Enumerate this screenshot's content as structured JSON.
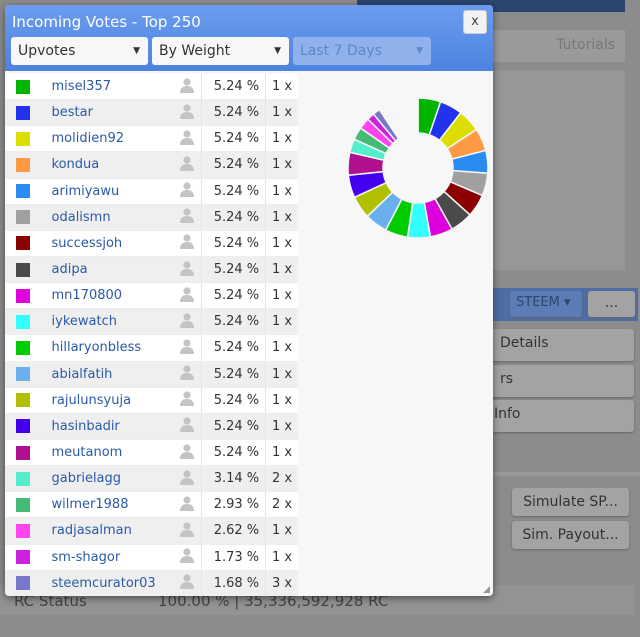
{
  "dialog": {
    "title": "Incoming Votes - Top 250",
    "close": "x",
    "filters": [
      {
        "value": "Upvotes"
      },
      {
        "value": "By Weight"
      },
      {
        "value": "Last 7 Days",
        "disabled": true
      }
    ]
  },
  "votes": [
    {
      "name": "misel357",
      "pct": "5.24 %",
      "count": "1 x",
      "color": "#00b400"
    },
    {
      "name": "bestar",
      "pct": "5.24 %",
      "count": "1 x",
      "color": "#2233ee"
    },
    {
      "name": "molidien92",
      "pct": "5.24 %",
      "count": "1 x",
      "color": "#dddd00"
    },
    {
      "name": "kondua",
      "pct": "5.24 %",
      "count": "1 x",
      "color": "#ff9944"
    },
    {
      "name": "arimiyawu",
      "pct": "5.24 %",
      "count": "1 x",
      "color": "#2a8cf0"
    },
    {
      "name": "odalismn",
      "pct": "5.24 %",
      "count": "1 x",
      "color": "#a0a0a0"
    },
    {
      "name": "successjoh",
      "pct": "5.24 %",
      "count": "1 x",
      "color": "#8b0000"
    },
    {
      "name": "adipa",
      "pct": "5.24 %",
      "count": "1 x",
      "color": "#4a4a4a"
    },
    {
      "name": "mn170800",
      "pct": "5.24 %",
      "count": "1 x",
      "color": "#dd00dd"
    },
    {
      "name": "iykewatch",
      "pct": "5.24 %",
      "count": "1 x",
      "color": "#33ffff"
    },
    {
      "name": "hillaryonbless",
      "pct": "5.24 %",
      "count": "1 x",
      "color": "#00cc00"
    },
    {
      "name": "abialfatih",
      "pct": "5.24 %",
      "count": "1 x",
      "color": "#6ab0ee"
    },
    {
      "name": "rajulunsyuja",
      "pct": "5.24 %",
      "count": "1 x",
      "color": "#b0c000"
    },
    {
      "name": "hasinbadir",
      "pct": "5.24 %",
      "count": "1 x",
      "color": "#4400ee"
    },
    {
      "name": "meutanom",
      "pct": "5.24 %",
      "count": "1 x",
      "color": "#b01090"
    },
    {
      "name": "gabrielagg",
      "pct": "3.14 %",
      "count": "2 x",
      "color": "#55eecc"
    },
    {
      "name": "wilmer1988",
      "pct": "2.93 %",
      "count": "2 x",
      "color": "#44bb77"
    },
    {
      "name": "radjasalman",
      "pct": "2.62 %",
      "count": "1 x",
      "color": "#ff44ee"
    },
    {
      "name": "sm-shagor",
      "pct": "1.73 %",
      "count": "1 x",
      "color": "#cc22dd"
    },
    {
      "name": "steemcurator03",
      "pct": "1.68 %",
      "count": "3 x",
      "color": "#7777cc"
    }
  ],
  "chart_data": {
    "type": "pie",
    "donut": true,
    "categories": [
      "misel357",
      "bestar",
      "molidien92",
      "kondua",
      "arimiyawu",
      "odalismn",
      "successjoh",
      "adipa",
      "mn170800",
      "iykewatch",
      "hillaryonbless",
      "abialfatih",
      "rajulunsyuja",
      "hasinbadir",
      "meutanom",
      "gabrielagg",
      "wilmer1988",
      "radjasalman",
      "sm-shagor",
      "steemcurator03"
    ],
    "values": [
      5.24,
      5.24,
      5.24,
      5.24,
      5.24,
      5.24,
      5.24,
      5.24,
      5.24,
      5.24,
      5.24,
      5.24,
      5.24,
      5.24,
      5.24,
      3.14,
      2.93,
      2.62,
      1.73,
      1.68
    ]
  },
  "background": {
    "tutorials": "Tutorials",
    "currency": "STEEM",
    "more": "...",
    "details": "Details",
    "rs": "rs",
    "info": "Info",
    "simulate_sp": "Simulate SP...",
    "sim_payout": "Sim. Payout...",
    "rc_label": "RC Status",
    "rc_value": "100.00 %  |  35,336,592,928 RC"
  }
}
